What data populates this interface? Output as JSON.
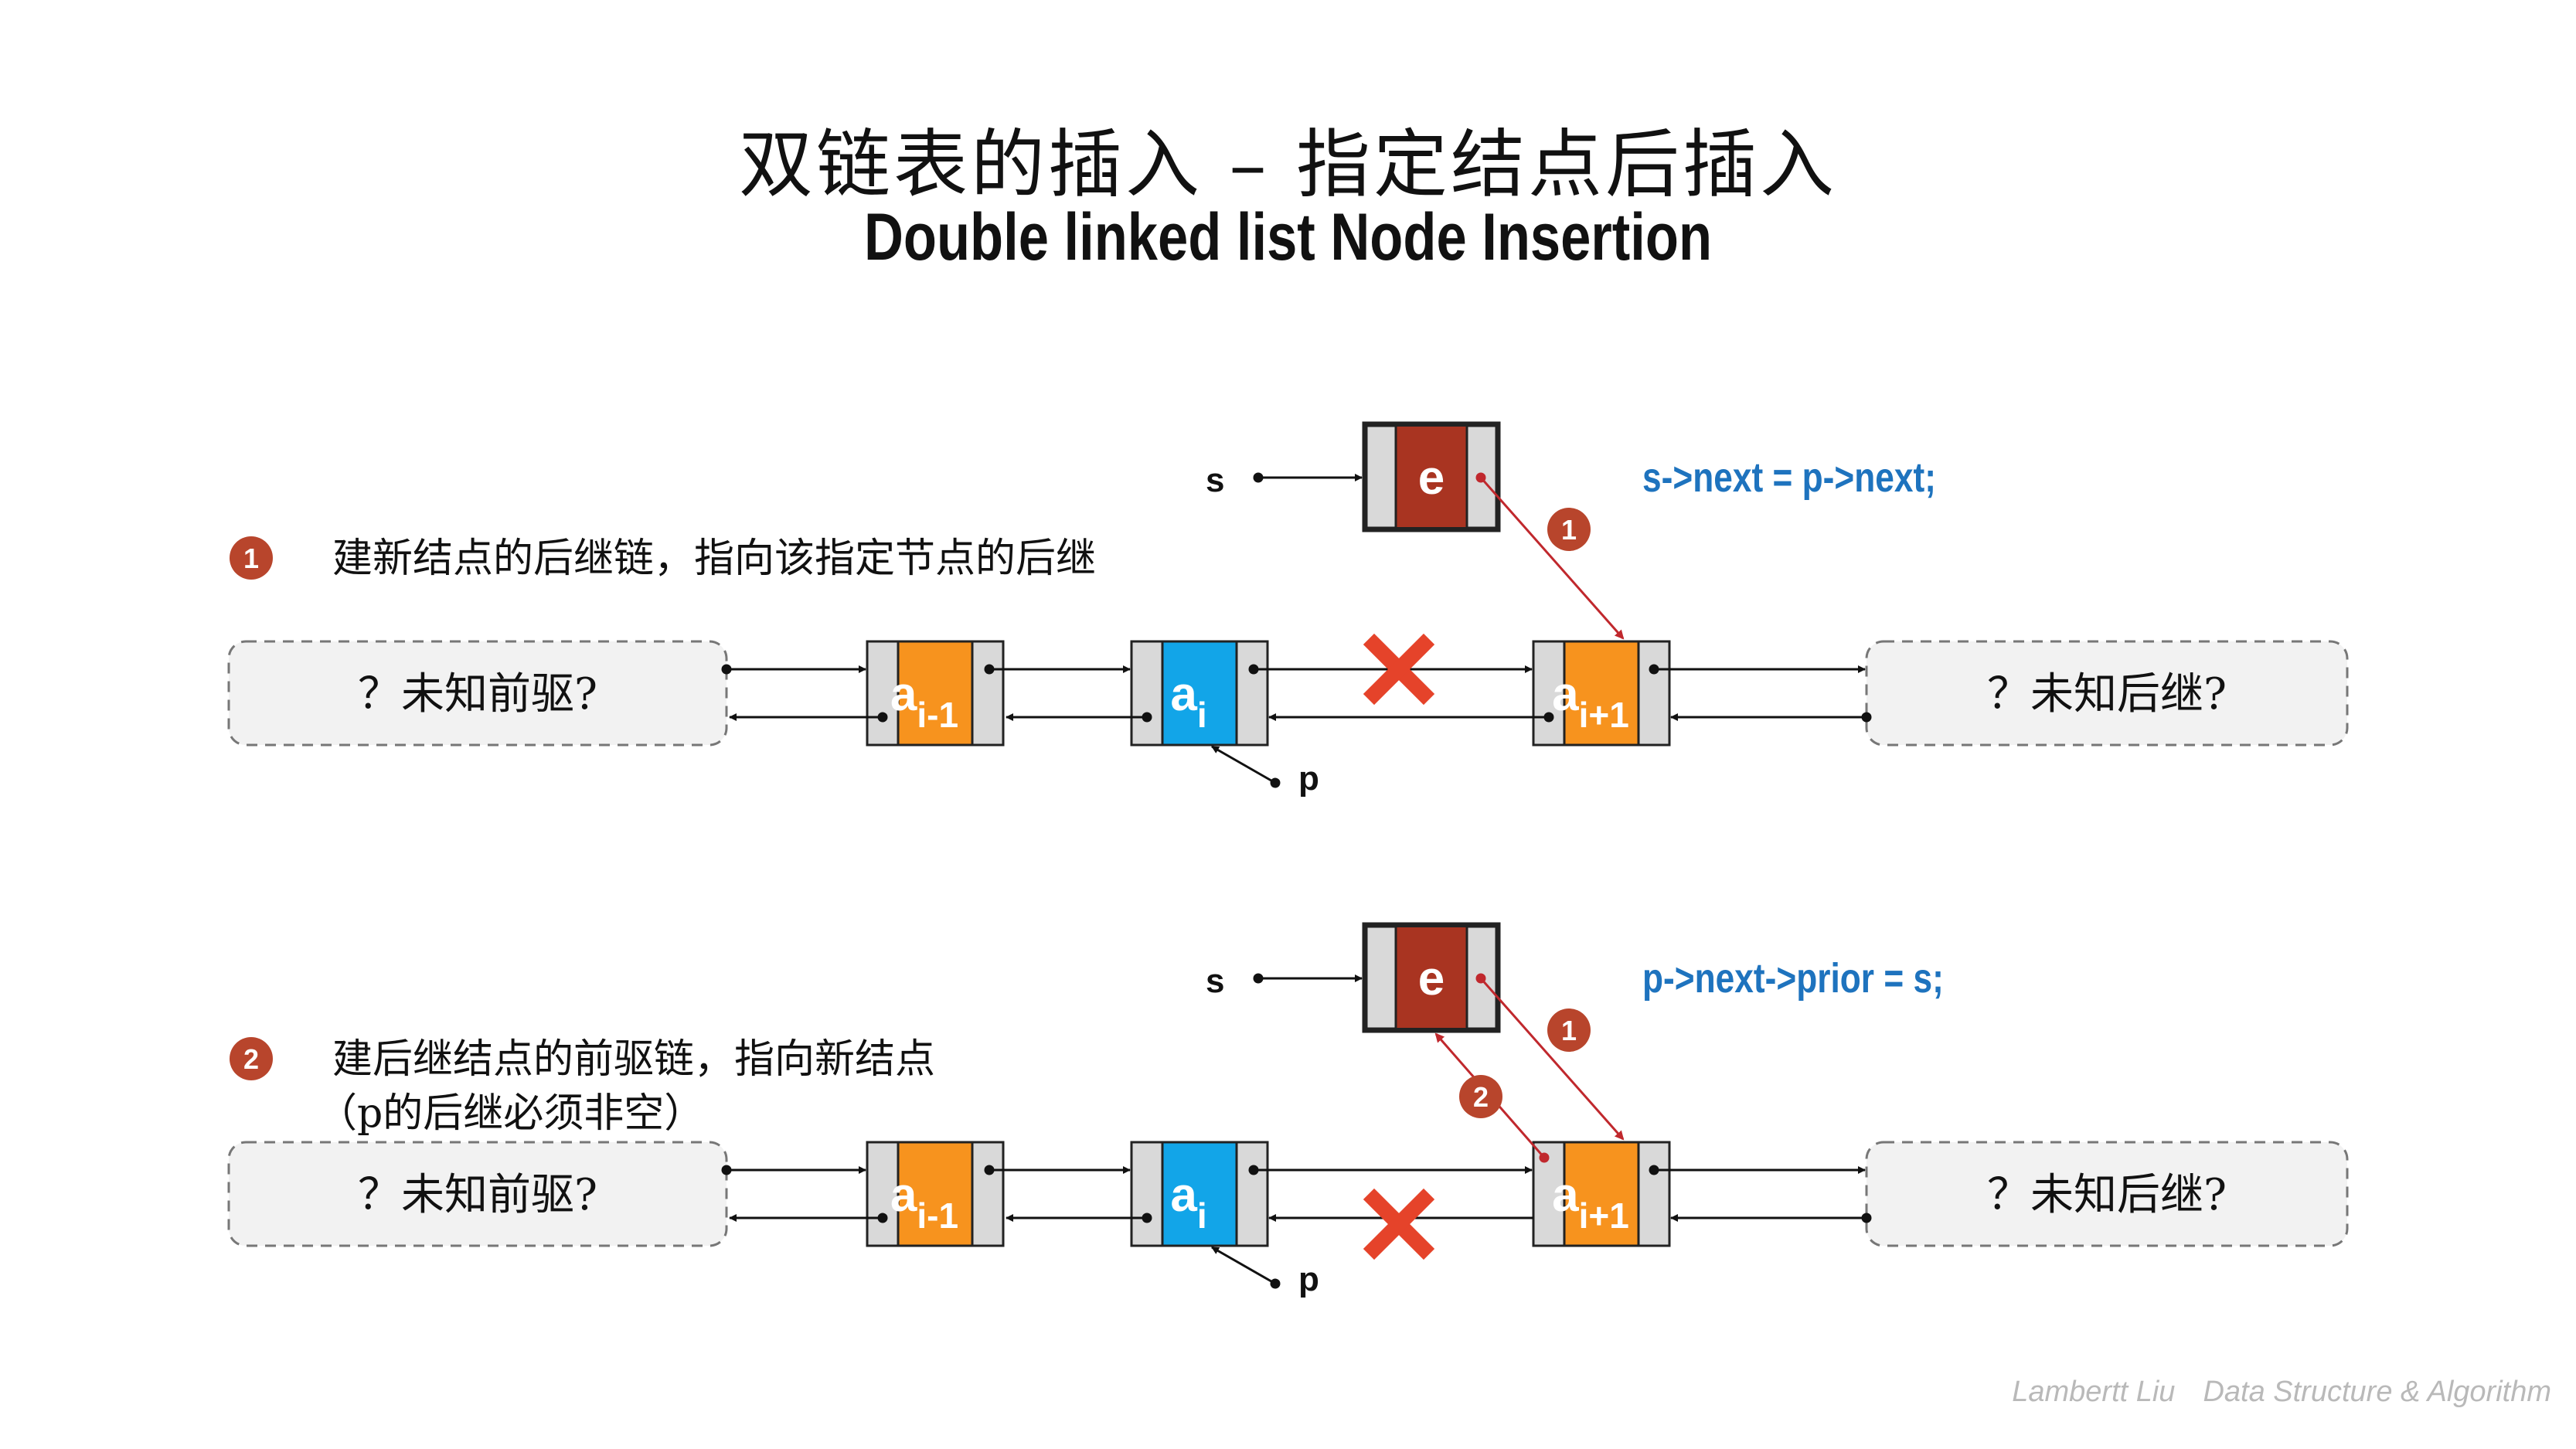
{
  "title": {
    "chinese": "双链表的插入 – 指定结点后插入",
    "english": "Double linked list Node Insertion"
  },
  "steps": [
    {
      "number": "1",
      "description_lines": [
        "建新结点的后继链，指向该指定节点的后继"
      ],
      "code": "s->next = p->next;",
      "new_node": {
        "label": "e",
        "pointer": "s"
      },
      "nodes": [
        {
          "base": "a",
          "sub": "i-1"
        },
        {
          "base": "a",
          "sub": "i"
        },
        {
          "base": "a",
          "sub": "i+1"
        }
      ],
      "current_pointer": "p",
      "unknown_left": "？未知前驱?",
      "unknown_right": "？未知后继?",
      "link_badges": [
        "1"
      ]
    },
    {
      "number": "2",
      "description_lines": [
        "建后继结点的前驱链，指向新结点",
        "（p的后继必须非空）"
      ],
      "code": "p->next->prior = s;",
      "new_node": {
        "label": "e",
        "pointer": "s"
      },
      "nodes": [
        {
          "base": "a",
          "sub": "i-1"
        },
        {
          "base": "a",
          "sub": "i"
        },
        {
          "base": "a",
          "sub": "i+1"
        }
      ],
      "current_pointer": "p",
      "unknown_left": "？未知前驱?",
      "unknown_right": "？未知后继?",
      "link_badges": [
        "1",
        "2"
      ]
    }
  ],
  "watermark": {
    "author": "Lambertt Liu",
    "subject": "Data Structure & Algorithm"
  },
  "colors": {
    "node_orange": "#F7931E",
    "node_blue": "#12A5E8",
    "node_new": "#A93421",
    "badge": "#B8452C",
    "arrow_red": "#C0282D",
    "code_blue": "#1E73BE",
    "cross": "#E5432A",
    "field_gray": "#D9D9D9",
    "unknown_fill": "#F2F2F2"
  },
  "icons": [
    "cross-icon"
  ]
}
